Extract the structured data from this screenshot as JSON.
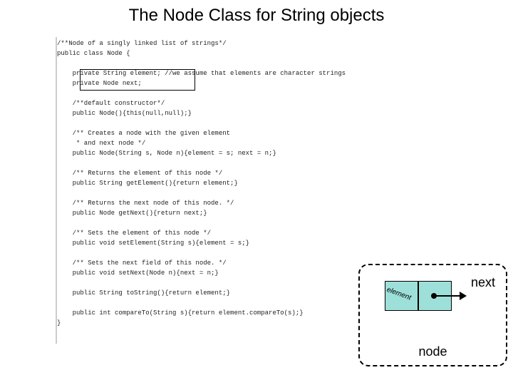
{
  "title": "The Node Class for String objects",
  "code": "/**Node of a singly linked list of strings*/\npublic class Node {\n\n    private String element; //we assume that elements are character strings\n    private Node next;\n\n    /**default constructor*/\n    public Node(){this(null,null);}\n\n    /** Creates a node with the given element\n     * and next node */\n    public Node(String s, Node n){element = s; next = n;}\n\n    /** Returns the element of this node */\n    public String getElement(){return element;}\n\n    /** Returns the next node of this node. */\n    public Node getNext(){return next;}\n\n    /** Sets the element of this node */\n    public void setElement(String s){element = s;}\n\n    /** Sets the next field of this node. */\n    public void setNext(Node n){next = n;}\n\n    public String toString(){return element;}\n\n    public int compareTo(String s){return element.compareTo(s);}\n}",
  "diagram": {
    "element_label": "element",
    "next_label": "next",
    "node_label": "node"
  }
}
